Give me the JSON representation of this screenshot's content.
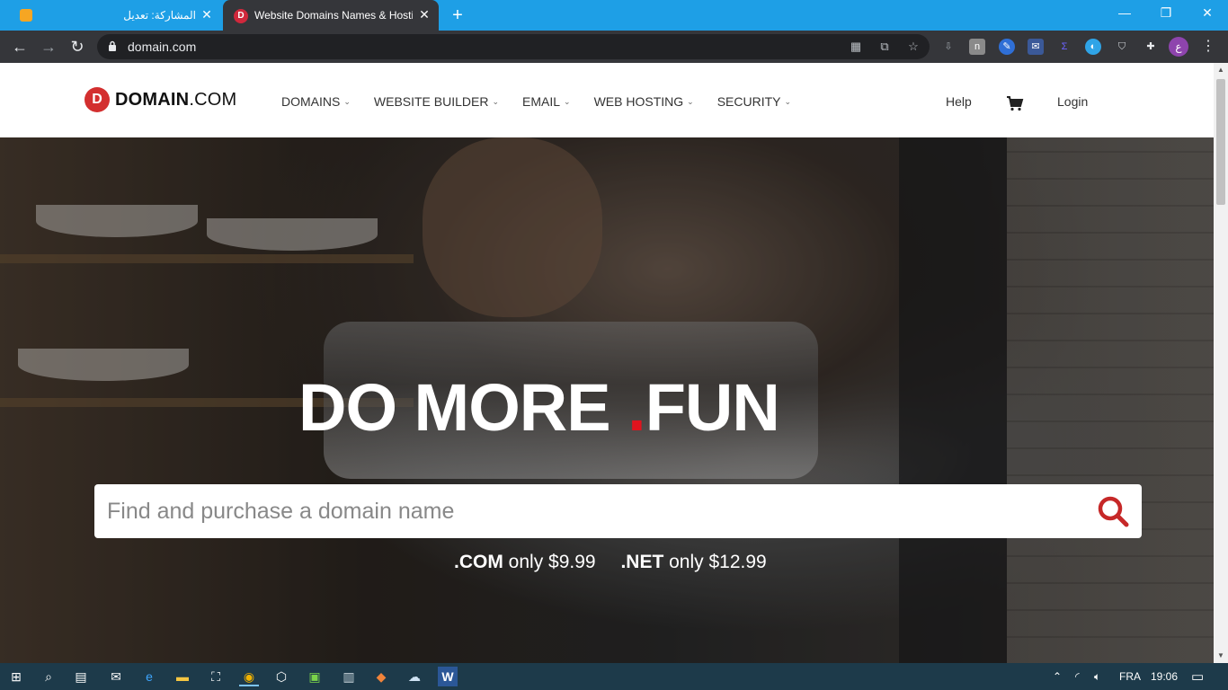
{
  "browser": {
    "tabs": [
      {
        "title": "المشاركة: تعديل",
        "favicon": "blogger-icon"
      },
      {
        "title": "Website Domains Names & Hosting",
        "favicon": "domain-icon",
        "active": true
      }
    ],
    "url": "domain.com"
  },
  "site": {
    "logo": {
      "brand": "DOMAIN",
      "tld": ".COM",
      "mark": "D"
    },
    "nav": [
      {
        "label": "DOMAINS"
      },
      {
        "label": "WEBSITE BUILDER"
      },
      {
        "label": "EMAIL"
      },
      {
        "label": "WEB HOSTING"
      },
      {
        "label": "SECURITY"
      }
    ],
    "help": "Help",
    "login": "Login",
    "hero": {
      "headline_part1": "DO MORE",
      "headline_dot": ".",
      "headline_part2": "FUN",
      "search_placeholder": "Find and purchase a domain name",
      "com_tld": ".COM",
      "com_price": "only $9.99",
      "net_tld": ".NET",
      "net_price": "only $12.99"
    },
    "colors": {
      "accent_red": "#e0141e",
      "search_icon": "#c62828"
    }
  },
  "taskbar": {
    "language": "FRA",
    "time": "19:06"
  }
}
